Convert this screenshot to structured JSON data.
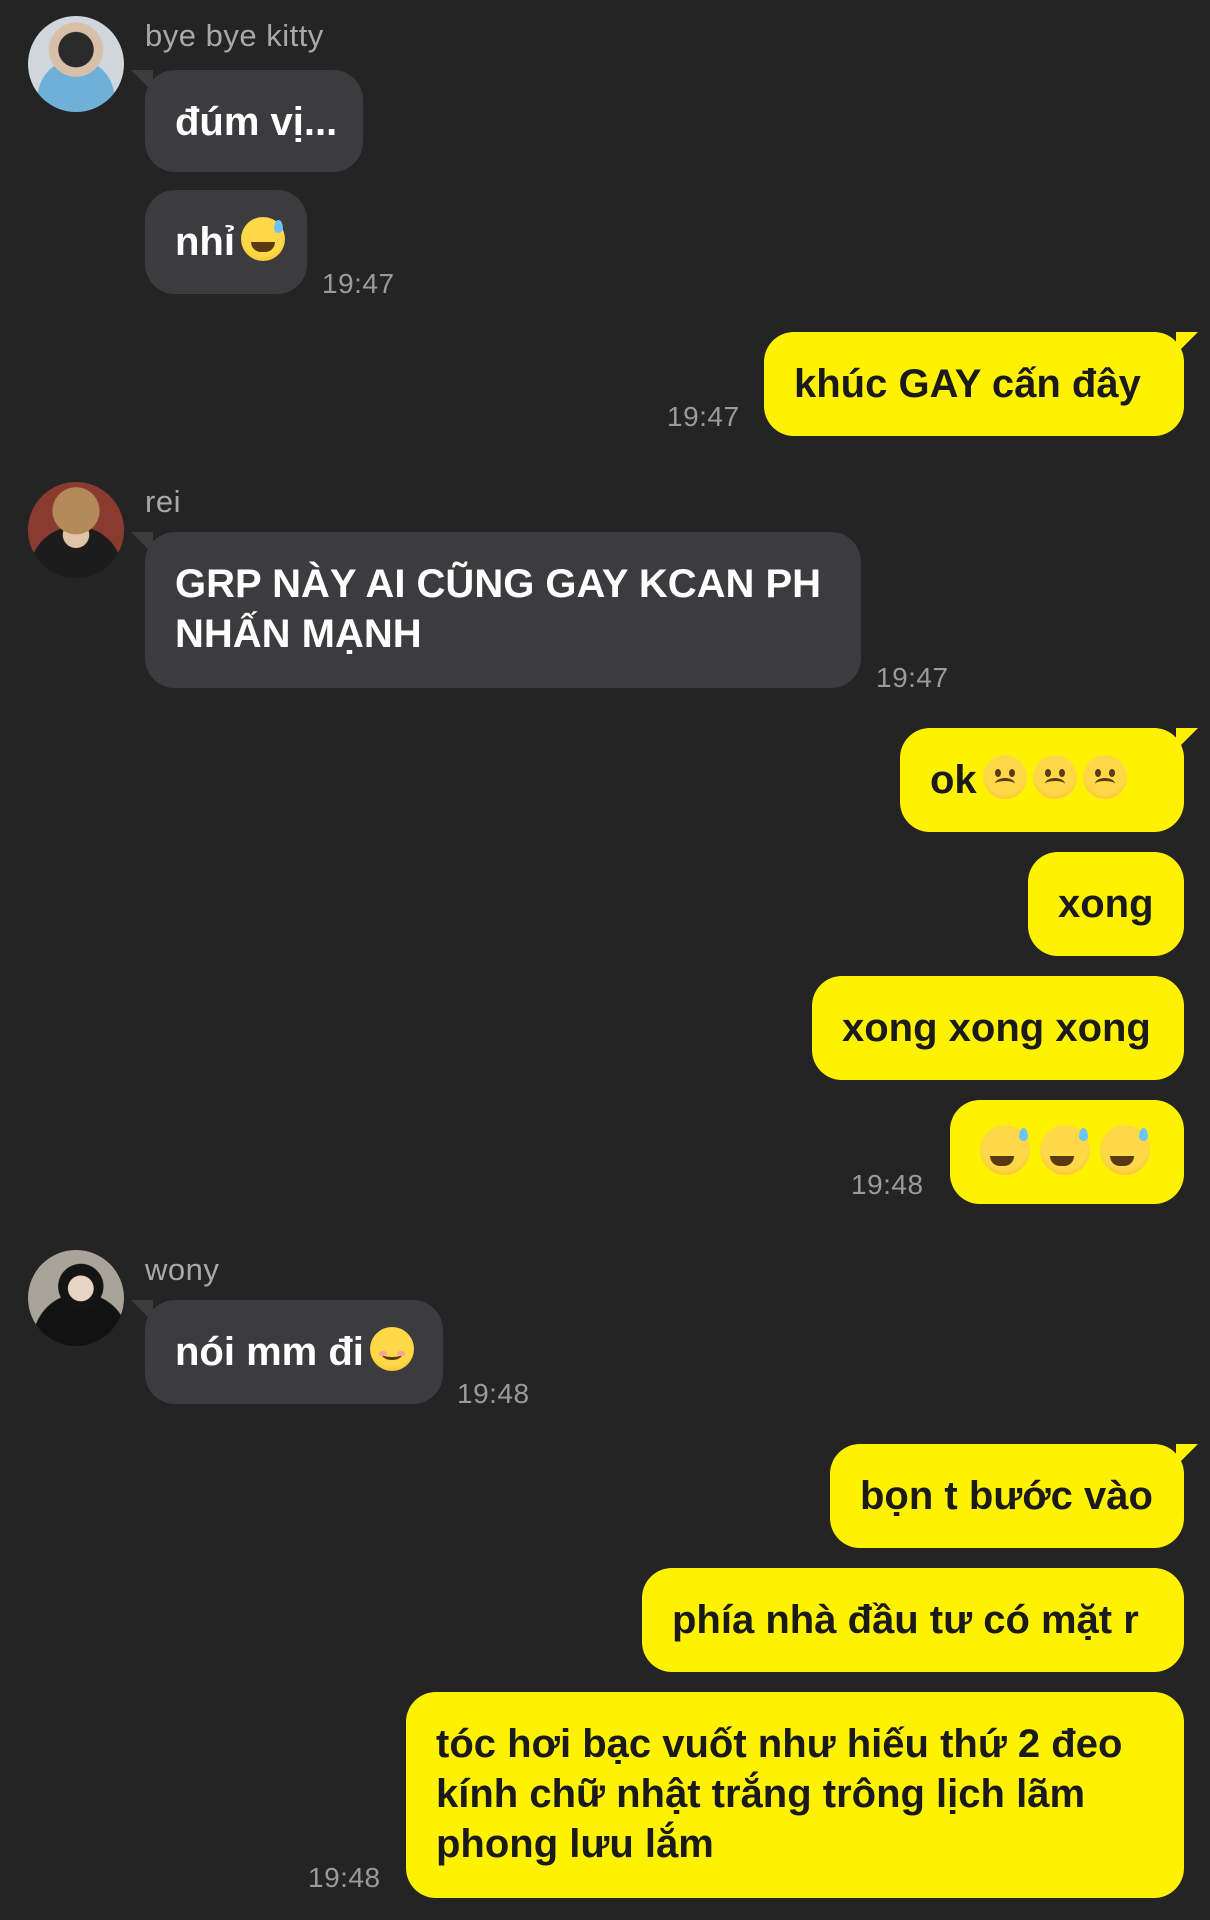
{
  "senders": {
    "kitty": "bye bye kitty",
    "rei": "rei",
    "wony": "wony"
  },
  "messages": {
    "m1": "đúm vị...",
    "m2": "nhỉ",
    "m3": "khúc GAY cấn đây",
    "m4": "GRP NÀY AI CŨNG GAY KCAN PH NHẤN MẠNH",
    "m5": "ok",
    "m6": "xong",
    "m7": "xong xong xong",
    "m9": "nói mm đi",
    "m10": "bọn t bước vào",
    "m11": "phía nhà đầu tư có mặt r",
    "m12": "tóc hơi bạc vuốt như hiếu thứ 2 đeo kính chữ nhật trắng trông lịch lãm phong lưu lắm"
  },
  "times": {
    "t1": "19:47",
    "t2": "19:47",
    "t3": "19:47",
    "t4": "19:48",
    "t5": "19:48",
    "t6": "19:48"
  },
  "emoji_icons": {
    "m2": "grinning-sweat",
    "m5": [
      "frowning",
      "frowning",
      "frowning"
    ],
    "m8": [
      "grinning-sweat",
      "grinning-sweat",
      "grinning-sweat"
    ],
    "m9": "smiling-relaxed"
  },
  "colors": {
    "background": "#242424",
    "incoming_bubble": "#3c3c3e",
    "outgoing_bubble": "#fff200",
    "timestamp": "#9a9a9a",
    "sender_name": "#a8a8a8"
  }
}
